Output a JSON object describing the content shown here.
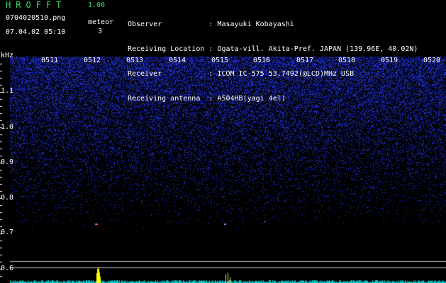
{
  "header": {
    "app_title": "HROFFT",
    "app_version": "1.00",
    "filename": "0704020510.png",
    "datetime": "07.04.02 05:10",
    "meteor_label": "meteor",
    "meteor_count": "3"
  },
  "info": [
    {
      "label": "Observer",
      "value": "Masayuki Kobayashi"
    },
    {
      "label": "Receiving Location",
      "value": "Ogata-vill. Akita-Pref. JAPAN (139.96E, 40.02N)"
    },
    {
      "label": "Receiver",
      "value": "ICOM IC-575 53.7492(@LCD)MHz USB"
    },
    {
      "label": "Receiving antenna",
      "value": "A504HB(yagi 4el)"
    }
  ],
  "axes": {
    "unit_label": "kHz",
    "y_ticks": [
      "1.1",
      "1.0",
      "0.9",
      "0.8",
      "0.7",
      "0.6"
    ],
    "x_ticks": [
      "0511",
      "0512",
      "0513",
      "0514",
      "0515",
      "0516",
      "0517",
      "0518",
      "0519",
      "0520"
    ]
  },
  "colors": {
    "title": "#3fd76a",
    "noise": "#5a6cff",
    "trace": "#ffffff",
    "meteor_peak": "#ffff00"
  }
}
